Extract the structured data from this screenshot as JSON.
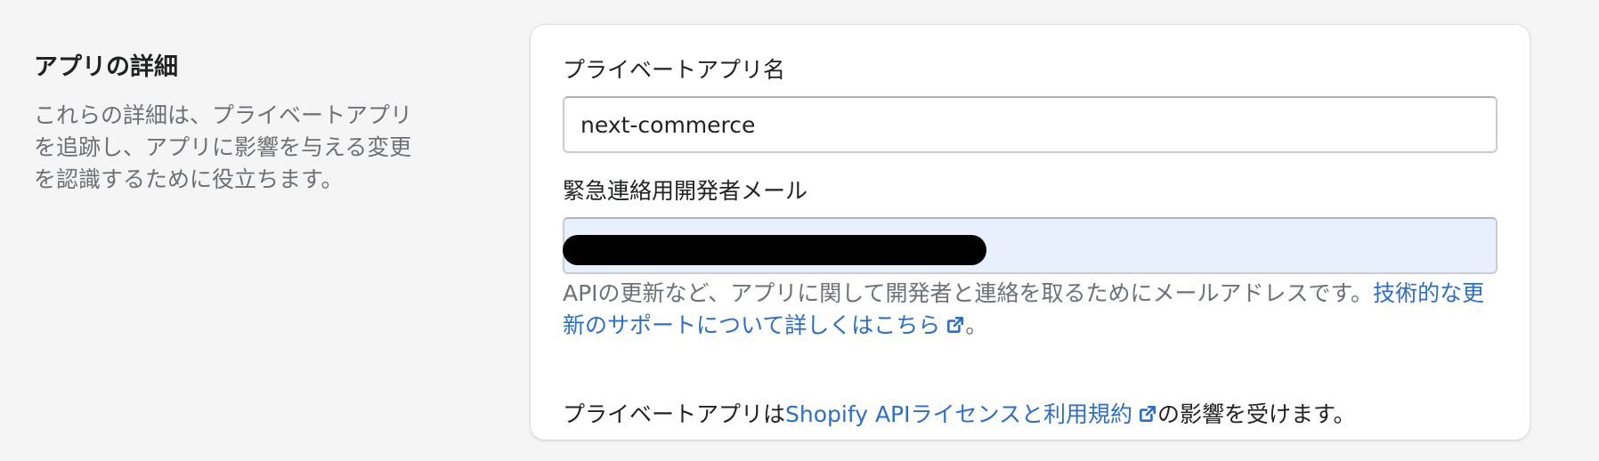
{
  "section": {
    "title": "アプリの詳細",
    "description": "これらの詳細は、プライベートアプリを追跡し、アプリに影響を与える変更を認識するために役立ちます。"
  },
  "form": {
    "app_name": {
      "label": "プライベートアプリ名",
      "value": "next-commerce"
    },
    "email": {
      "label": "緊急連絡用開発者メール",
      "value": "",
      "redacted": true,
      "help_text": "APIの更新など、アプリに関して開発者と連絡を取るためにメールアドレスです。",
      "help_link_text": "技術的な更新のサポートについて詳しくはこちら",
      "help_end": "。"
    },
    "footer": {
      "prefix": "プライベートアプリは",
      "link_text": "Shopify APIライセンスと利用規約",
      "suffix": "の影響を受けます。"
    }
  },
  "colors": {
    "background": "#f5f5f5",
    "card": "#ffffff",
    "link": "#2c6ecb",
    "muted_text": "#6d7175",
    "autofill_bg": "#e8f0fe"
  },
  "icons": {
    "external_link": "external-link-icon"
  }
}
